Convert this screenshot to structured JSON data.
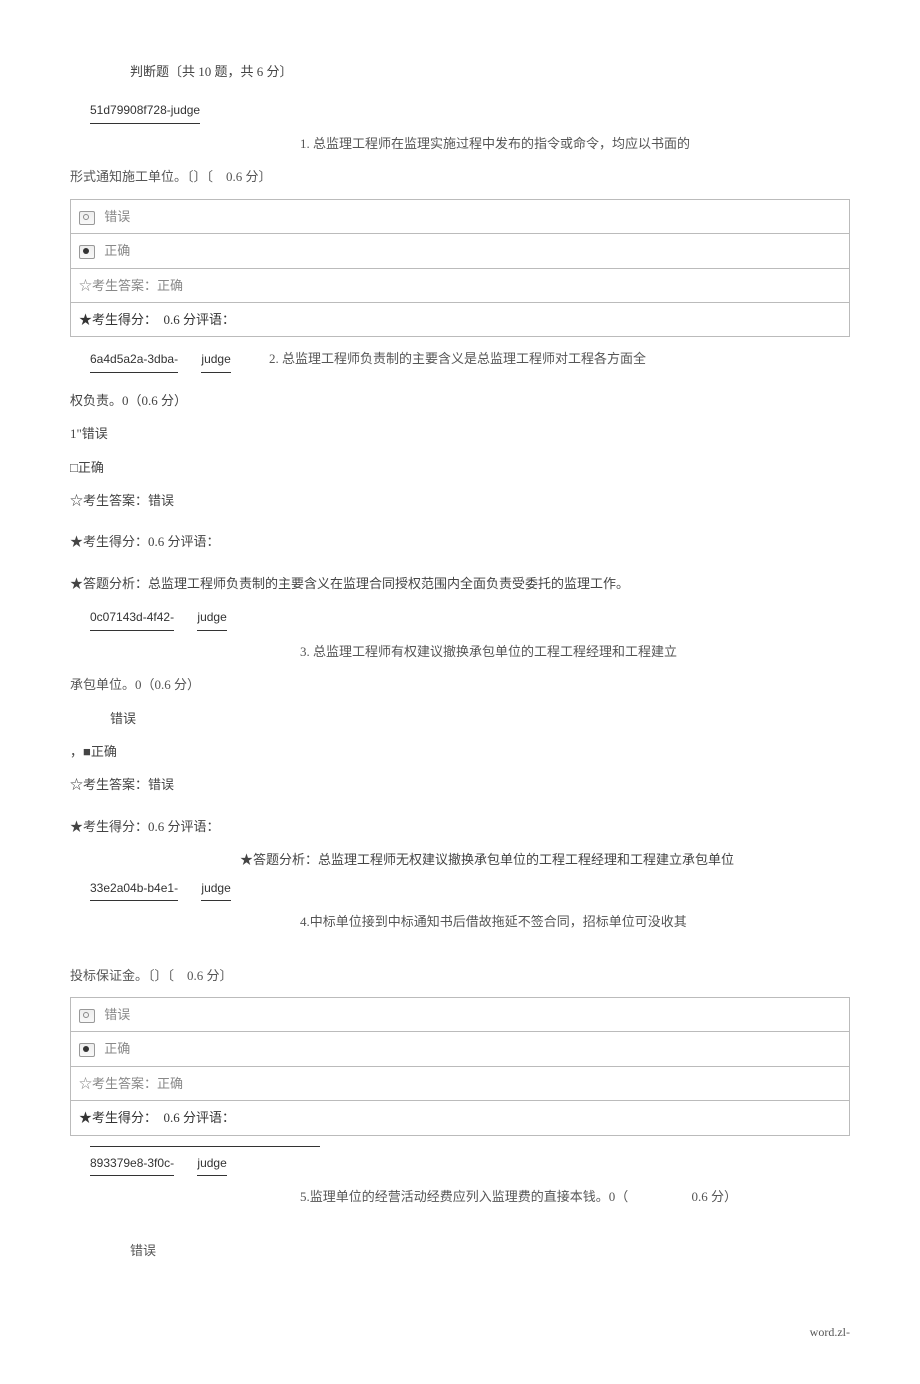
{
  "header": {
    "section_title": "判断题〔共 10 题，共 6 分〕"
  },
  "questions": [
    {
      "id_display": "51d79908f728-judge",
      "lead": "1. 总监理工程师在监理实施过程中发布的指令或命令，均应以书面的",
      "cont": "形式通知施工单位。〔〕〔　0.6 分〕",
      "opt_false": "错误",
      "opt_true": "正确",
      "cand_answer": "☆考生答案：正确",
      "score_line": "★考生得分：　0.6 分评语：",
      "analysis": ""
    },
    {
      "id_part1": "6a4d5a2a-3dba-",
      "id_part2": "judge",
      "lead": "2. 总监理工程师负责制的主要含义是总监理工程师对工程各方面全",
      "cont": "权负责。0（0.6 分）",
      "opt_false": "1\"错误",
      "opt_true": "□正确",
      "cand_answer": "☆考生答案：错误",
      "score_line": "★考生得分：0.6 分评语：",
      "analysis": "★答题分析：总监理工程师负责制的主要含义在监理合同授权范围内全面负责受委托的监理工作。"
    },
    {
      "id_part1": "0c07143d-4f42-",
      "id_part2": "judge",
      "lead": "3. 总监理工程师有权建议撤换承包单位的工程工程经理和工程建立",
      "cont": "承包单位。0（0.6 分）",
      "opt_false": "错误",
      "opt_true": "，■正确",
      "cand_answer": "☆考生答案：错误",
      "score_line": "★考生得分：0.6 分评语：",
      "analysis": "★答题分析：总监理工程师无权建议撤换承包单位的工程工程经理和工程建立承包单位"
    },
    {
      "id_part1": "33e2a04b-b4e1-",
      "id_part2": "judge",
      "lead": "4.中标单位接到中标通知书后借故拖延不签合同，招标单位可没收其",
      "cont": "投标保证金。〔〕〔　0.6 分〕",
      "opt_false": "错误",
      "opt_true": "正确",
      "cand_answer": "☆考生答案：正确",
      "score_line": "★考生得分：　0.6 分评语：",
      "analysis": ""
    },
    {
      "id_part1": "893379e8-3f0c-",
      "id_part2": "judge",
      "lead": "5.监理单位的经营活动经费应列入监理费的直接本钱。0（",
      "score": "0.6 分）",
      "opt_false": "错误"
    }
  ],
  "footer": {
    "text": "word.zl-"
  }
}
